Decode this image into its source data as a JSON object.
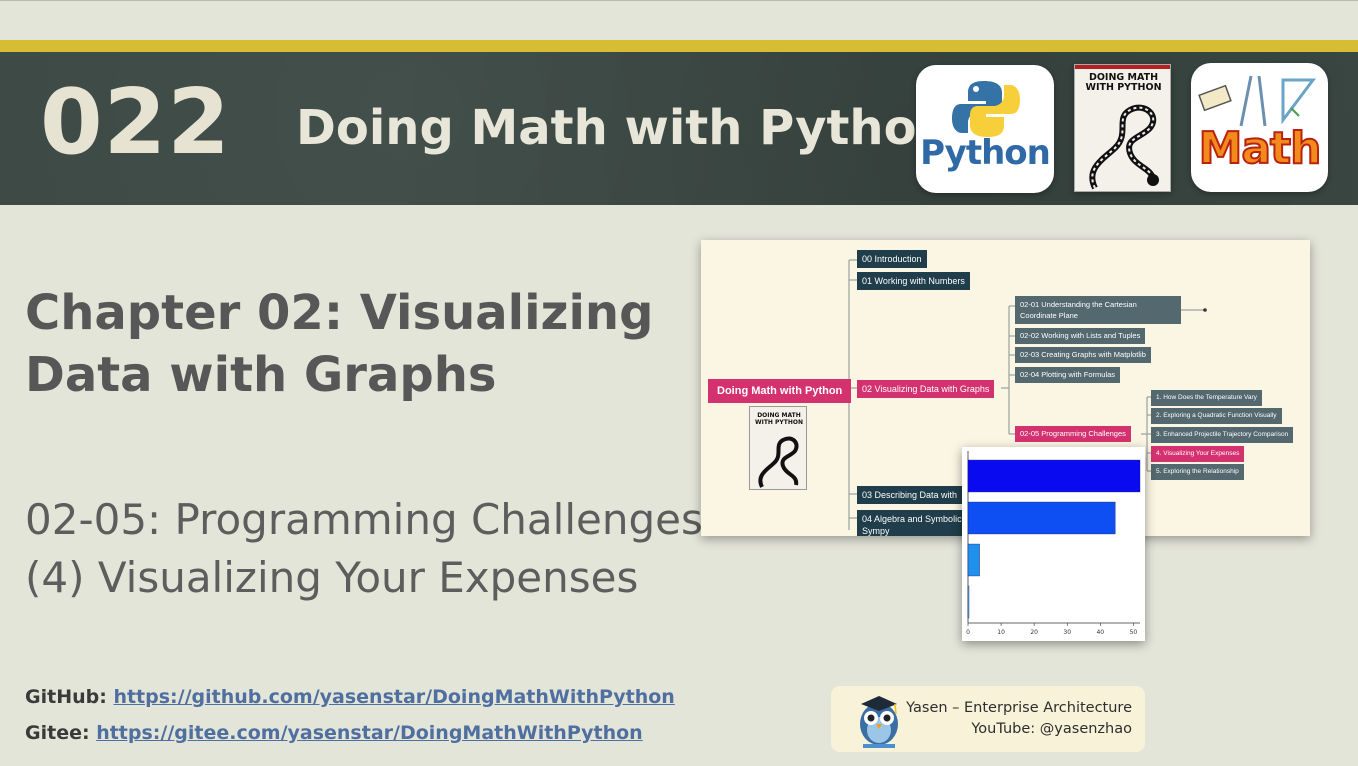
{
  "header": {
    "episode": "022",
    "title": "Doing Math with Python",
    "python_logo_text": "Python",
    "book_title": "DOING MATH WITH PYTHON",
    "math_logo_text": "Math"
  },
  "main": {
    "chapter_title": "Chapter 02: Visualizing Data with Graphs",
    "section_line1": "02-05: Programming Challenges",
    "section_line2": "(4) Visualizing Your Expenses"
  },
  "links": {
    "github_label": "GitHub:",
    "github_url": "https://github.com/yasenstar/DoingMathWithPython",
    "gitee_label": "Gitee:",
    "gitee_url": "https://gitee.com/yasenstar/DoingMathWithPython"
  },
  "author": {
    "line1": "Yasen – Enterprise Architecture",
    "line2": "YouTube: @yasenzhao",
    "avatar_icon": "owl-graduate-icon"
  },
  "mindmap": {
    "root": "Doing Math with Python",
    "book_title": "DOING MATH WITH PYTHON",
    "chapters": [
      "00 Introduction",
      "01 Working with Numbers",
      "02 Visualizing Data with Graphs",
      "03 Describing Data with",
      "04 Algebra and Symbolic",
      "Sympy"
    ],
    "sections": [
      "02-01 Understanding the Cartesian",
      "Coordinate Plane",
      "02-02 Working with Lists and Tuples",
      "02-03 Creating Graphs with Matplotlib",
      "02-04 Plotting with Formulas",
      "02-05 Programming Challenges"
    ],
    "challenges": [
      "1. How Does the Temperature Vary",
      "2. Exploring a Quadratic Function Visually",
      "3. Enhanced Projectile Trajectory Comparison",
      "4. Visualizing Your Expenses",
      "5. Exploring the Relationship"
    ],
    "colors": {
      "dark": "#1f3d4a",
      "mid": "#53686f",
      "pink": "#d4326e"
    }
  },
  "chart_data": {
    "type": "bar",
    "orientation": "horizontal",
    "categories": [
      "",
      "",
      "",
      ""
    ],
    "values": [
      52,
      44.5,
      3.5,
      0.3
    ],
    "colors": [
      "#0a0af0",
      "#0d4ff2",
      "#1f90ec",
      "#5ec3ef"
    ],
    "xlim": [
      0,
      52
    ],
    "xticks": [
      "0",
      "10",
      "20",
      "30",
      "40",
      "50"
    ],
    "title": "",
    "xlabel": "",
    "ylabel": ""
  }
}
